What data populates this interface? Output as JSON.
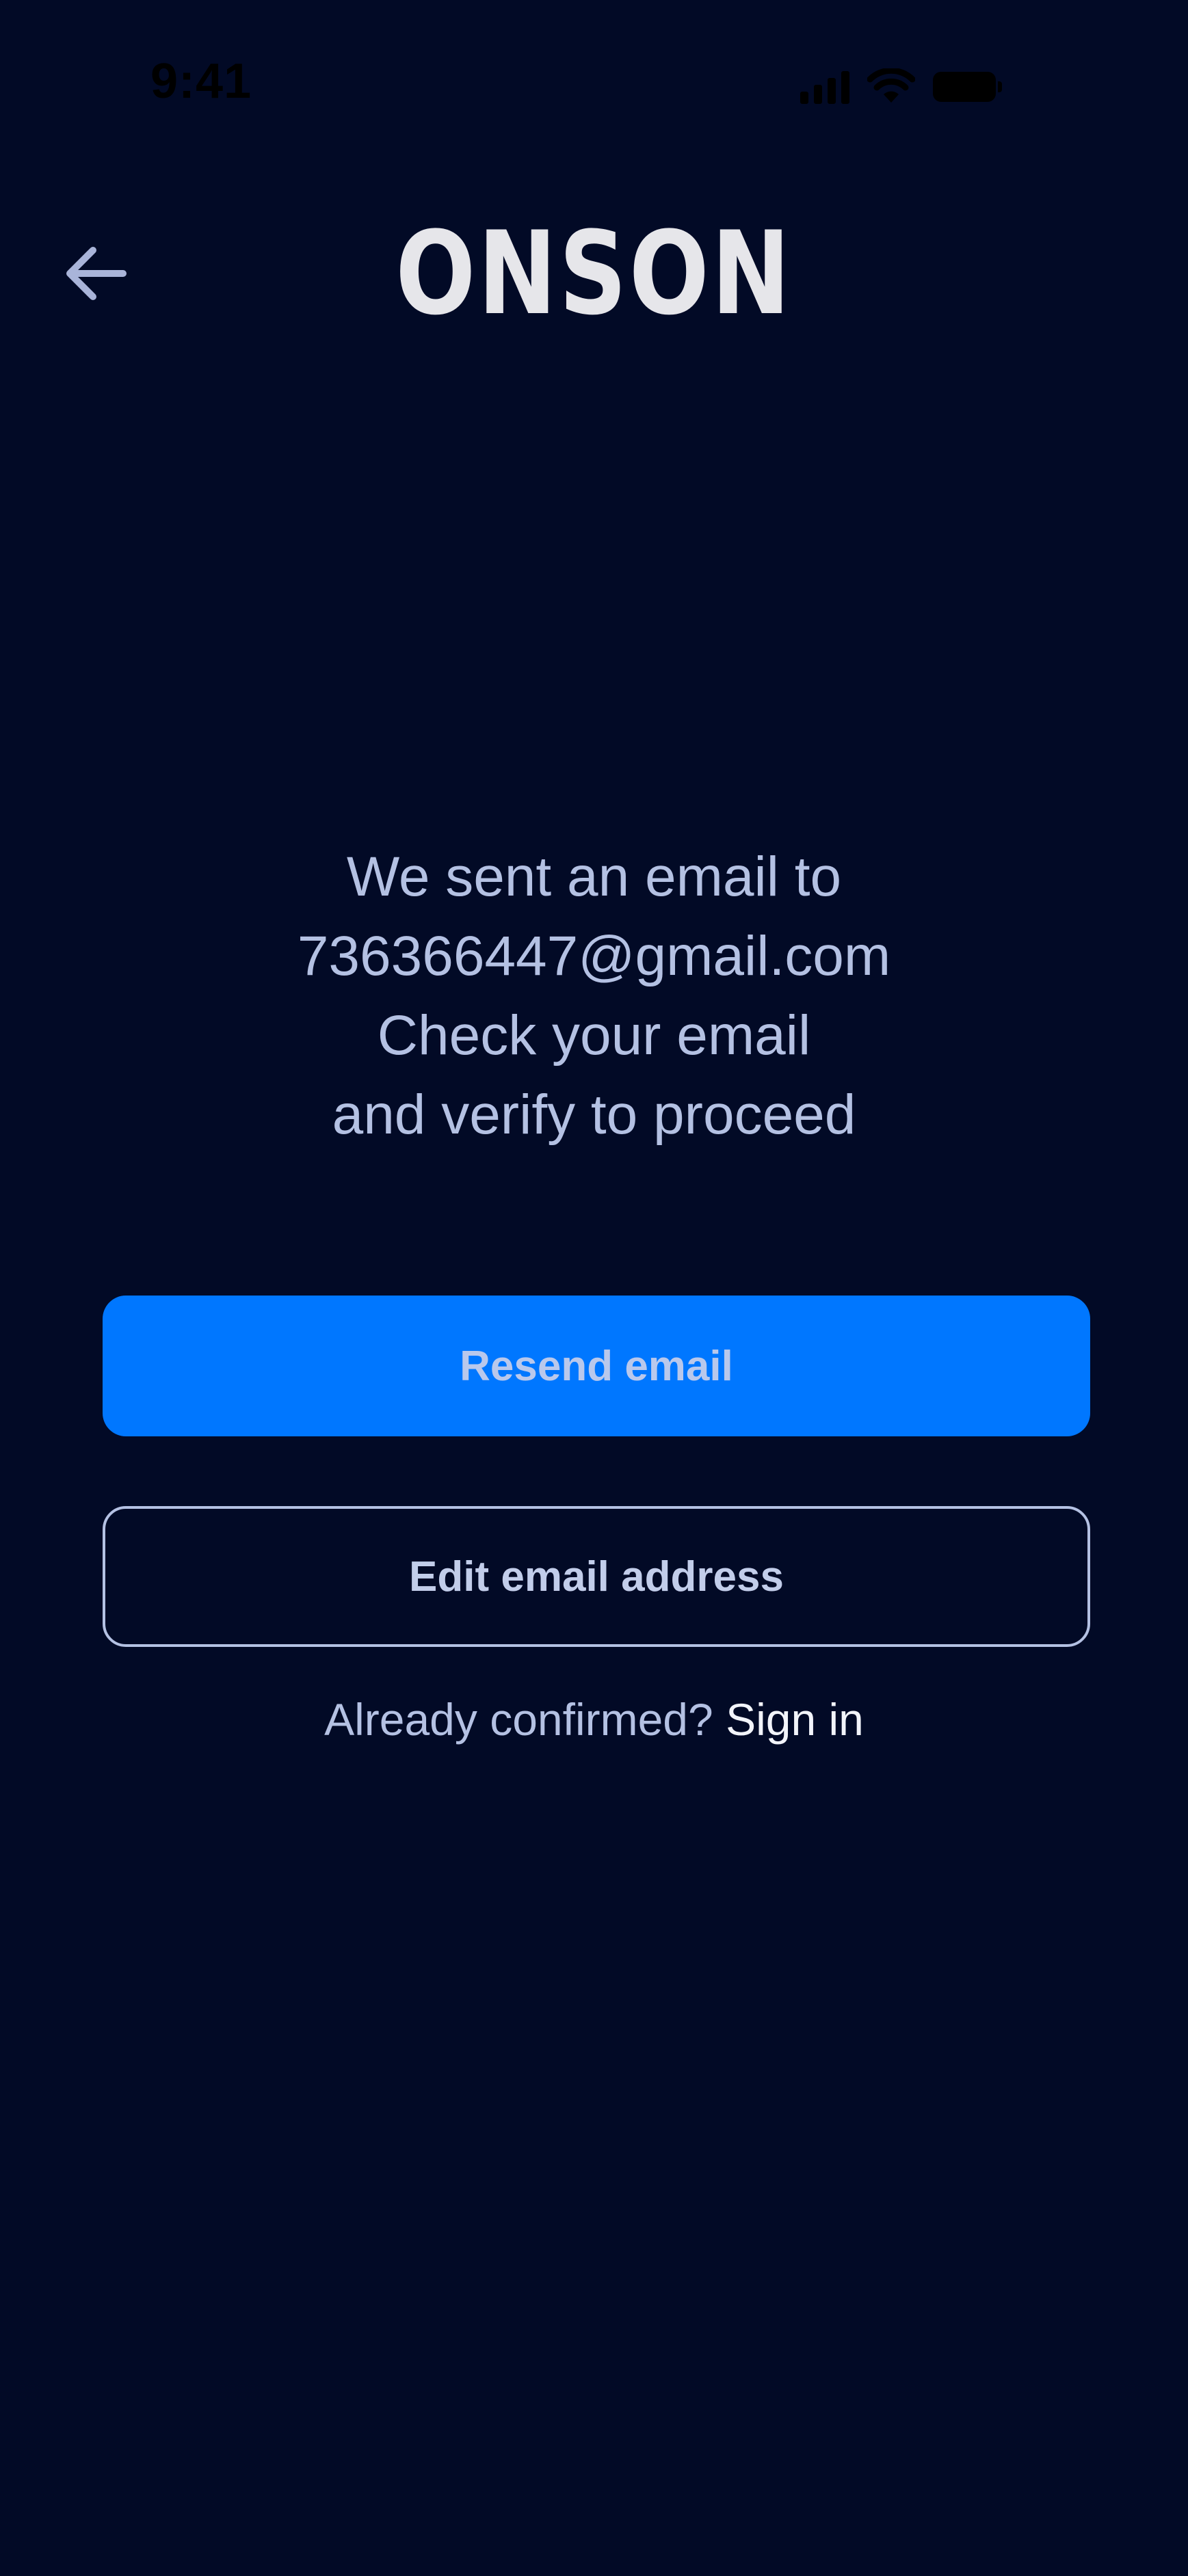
{
  "status_bar": {
    "time": "9:41",
    "icons": [
      "cellular-signal-icon",
      "wifi-icon",
      "battery-icon"
    ]
  },
  "header": {
    "back_icon": "arrow-left-icon",
    "logo_text": "ONSON"
  },
  "message": {
    "line1": "We sent an email to",
    "email": "736366447@gmail.com",
    "line3": "Check your email",
    "line4": "and verify to proceed"
  },
  "actions": {
    "resend_label": "Resend email",
    "edit_label": "Edit email address"
  },
  "signin": {
    "prompt": "Already confirmed?",
    "link_label": "Sign in"
  },
  "colors": {
    "background": "#020A26",
    "accent": "#0077FF",
    "text_muted": "#B4C1E3",
    "text_bright": "#F2F4FA"
  }
}
